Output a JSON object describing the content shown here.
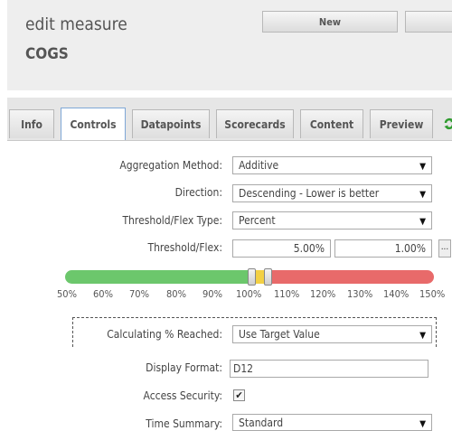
{
  "header": {
    "title": "edit measure",
    "measure_name": "COGS",
    "new_button": "New",
    "second_button": ""
  },
  "tabs": [
    {
      "label": "Info"
    },
    {
      "label": "Controls"
    },
    {
      "label": "Datapoints"
    },
    {
      "label": "Scorecards"
    },
    {
      "label": "Content"
    },
    {
      "label": "Preview"
    }
  ],
  "form": {
    "aggregation_method": {
      "label": "Aggregation Method:",
      "value": "Additive"
    },
    "direction": {
      "label": "Direction:",
      "value": "Descending - Lower is better"
    },
    "threshold_type": {
      "label": "Threshold/Flex Type:",
      "value": "Percent"
    },
    "threshold_flex": {
      "label": "Threshold/Flex:",
      "threshold": "5.00%",
      "flex": "1.00%"
    },
    "calculating_reached": {
      "label": "Calculating % Reached:",
      "value": "Use Target Value"
    },
    "display_format": {
      "label": "Display Format:",
      "value": "D12"
    },
    "access_security": {
      "label": "Access Security:",
      "checked": true
    },
    "time_summary": {
      "label": "Time Summary:",
      "value": "Standard"
    }
  },
  "gauge": {
    "ticks": [
      "50%",
      "60%",
      "70%",
      "80%",
      "90%",
      "100%",
      "110%",
      "120%",
      "130%",
      "140%",
      "150%"
    ],
    "green": "#6cc76c",
    "yellow": "#f3d044",
    "red": "#e86a6a"
  },
  "icons": {
    "dropdown": "▼",
    "refresh": "refresh-icon",
    "check": "✔",
    "ellipsis": "..."
  }
}
